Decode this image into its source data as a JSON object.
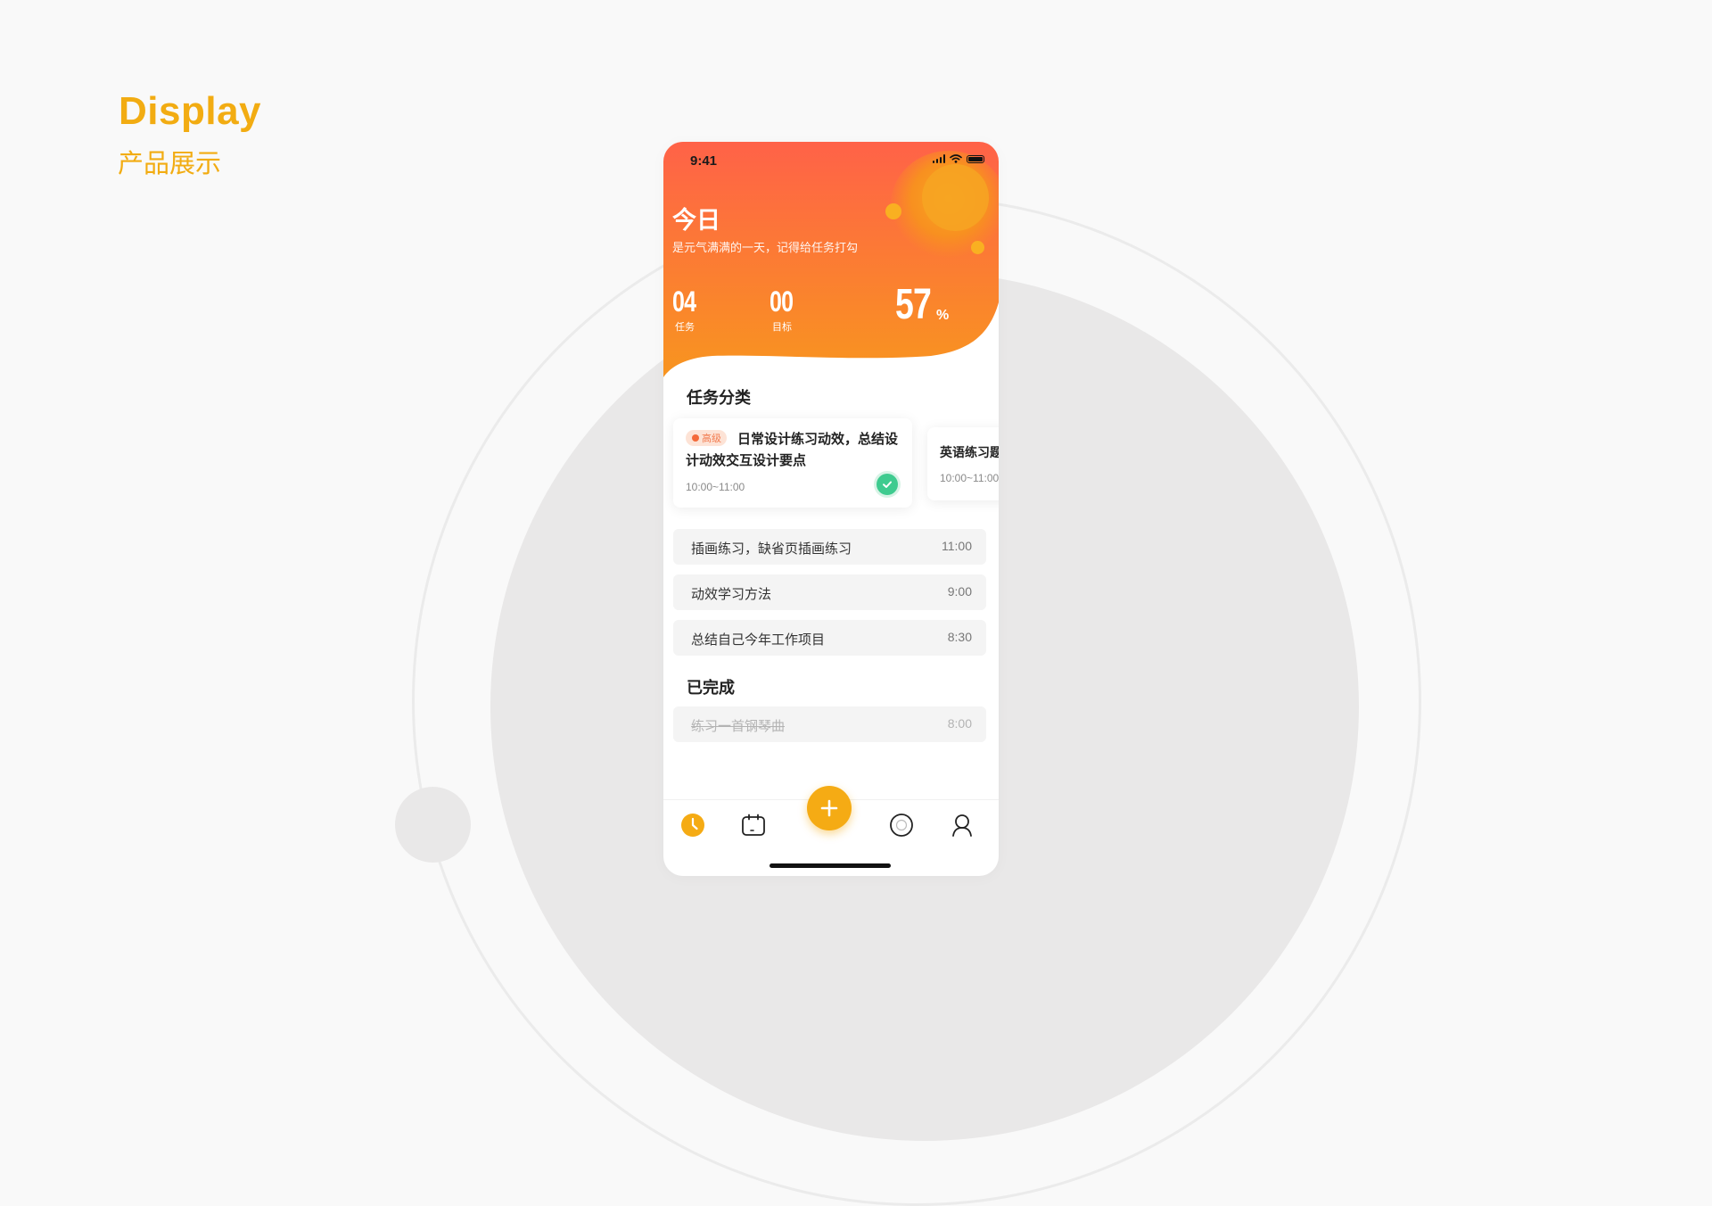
{
  "page": {
    "heading_en": "Display",
    "heading_cn": "产品展示",
    "accent_color": "#f2ac12"
  },
  "phone": {
    "status_bar": {
      "time": "9:41"
    },
    "header": {
      "title": "今日",
      "subtitle": "是元气满满的一天，记得给任务打勾",
      "gradient_colors": [
        "#ff6248",
        "#f8951f"
      ],
      "stats": [
        {
          "value": "04",
          "label": "任务"
        },
        {
          "value": "00",
          "label": "目标"
        }
      ],
      "progress": {
        "value": "57",
        "unit": "%"
      }
    },
    "categories": {
      "title": "任务分类",
      "cards": [
        {
          "tag": "高级",
          "title": "日常设计练习动效，总结设计动效交互设计要点",
          "time": "10:00~11:00",
          "done": true
        },
        {
          "title": "英语练习题",
          "time": "10:00~11:00"
        }
      ]
    },
    "tasks": [
      {
        "text": "插画练习，缺省页插画练习",
        "time": "11:00"
      },
      {
        "text": "动效学习方法",
        "time": "9:00"
      },
      {
        "text": "总结自己今年工作项目",
        "time": "8:30"
      }
    ],
    "completed": {
      "title": "已完成",
      "items": [
        {
          "text": "练习一首钢琴曲",
          "time": "8:00"
        }
      ]
    },
    "tabbar": {
      "icons": [
        "clock-icon",
        "calendar-icon",
        "add-icon",
        "circle-icon",
        "user-icon"
      ],
      "active_color": "#f5ab14"
    }
  }
}
